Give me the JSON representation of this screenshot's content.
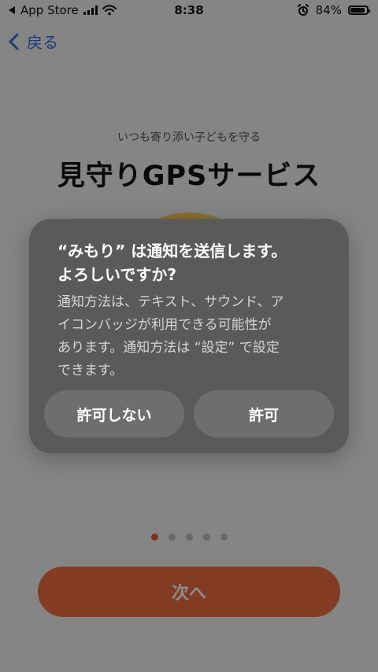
{
  "status_bar": {
    "left_app": "App Store",
    "time": "8:38",
    "battery_percent": "84%",
    "battery_level": 0.84
  },
  "nav": {
    "back_label": "戻る"
  },
  "hero": {
    "subtitle": "いつも寄り添い子どもを守る",
    "title": "見守りGPSサービス"
  },
  "pagination": {
    "total": 5,
    "active_index": 0
  },
  "cta": {
    "next_label": "次へ"
  },
  "alert": {
    "title_line1": "“みもり” は通知を送信します。",
    "title_line2": "よろしいですか?",
    "body_line1": "通知方法は、テキスト、サウンド、ア",
    "body_line2": "イコンバッジが利用できる可能性が",
    "body_line3": "あります。通知方法は “設定” で設定",
    "body_line4": "できます。",
    "deny_label": "許可しない",
    "allow_label": "許可"
  },
  "colors": {
    "accent_blue": "#2f6fd6",
    "cta_orange": "#ef6e43",
    "dot_active": "#e2573d",
    "alert_bg": "#5a5a5a"
  }
}
